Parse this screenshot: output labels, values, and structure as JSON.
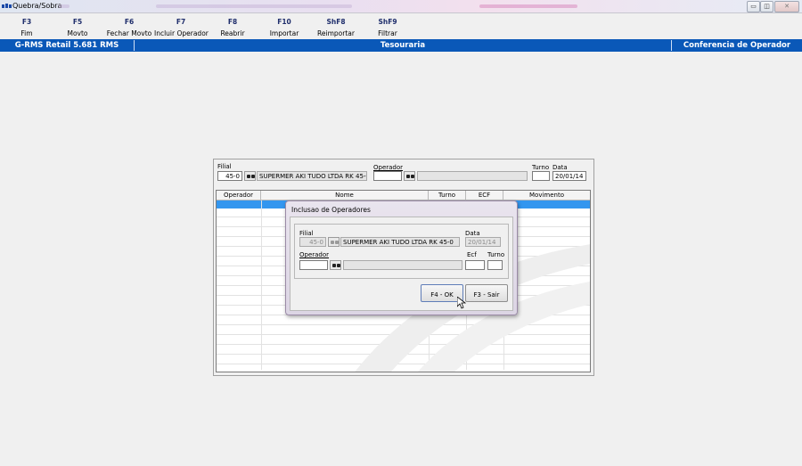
{
  "window": {
    "title": "Quebra/Sobra",
    "controls": {
      "minimize": "▭",
      "restore": "◫",
      "close": "✕"
    }
  },
  "toolbar": {
    "items": [
      {
        "key": "F3",
        "label": "Fim"
      },
      {
        "key": "F5",
        "label": "Movto"
      },
      {
        "key": "F6",
        "label": "Fechar Movto"
      },
      {
        "key": "F7",
        "label": "Incluir Operador"
      },
      {
        "key": "F8",
        "label": "Reabrir"
      },
      {
        "key": "F10",
        "label": "Importar"
      },
      {
        "key": "ShF8",
        "label": "Reimportar"
      },
      {
        "key": "ShF9",
        "label": "Filtrar"
      }
    ]
  },
  "statusbar": {
    "version": "G-RMS Retail 5.681 RMS",
    "module": "Tesouraria",
    "screen": "Conferencia de Operador"
  },
  "filter": {
    "filial_label": "Filial",
    "filial_value": "45-0",
    "filial_name": "SUPERMER AKI TUDO LTDA RK 45-0",
    "operador_label": "Operador",
    "operador_value": "",
    "operador_name": "",
    "turno_label": "Turno",
    "turno_value": "",
    "data_label": "Data",
    "data_value": "20/01/14"
  },
  "grid": {
    "columns": [
      "Operador",
      "Nome",
      "Turno",
      "ECF",
      "Movimento"
    ]
  },
  "dialog": {
    "title": "Inclusao de Operadores",
    "filial_label": "Filial",
    "filial_value": "45-0",
    "filial_name": "SUPERMER AKI TUDO LTDA RK 45-0",
    "data_label": "Data",
    "data_value": "20/01/14",
    "operador_label": "Operador",
    "operador_value": "",
    "operador_name": "",
    "ecf_label": "Ecf",
    "ecf_value": "",
    "turno_label": "Turno",
    "turno_value": "",
    "ok_label": "F4 - OK",
    "cancel_label": "F3 - Sair"
  },
  "colors": {
    "status_bar": "#0a58b8",
    "selection": "#3396ef",
    "key_text": "#1e2d6b"
  }
}
